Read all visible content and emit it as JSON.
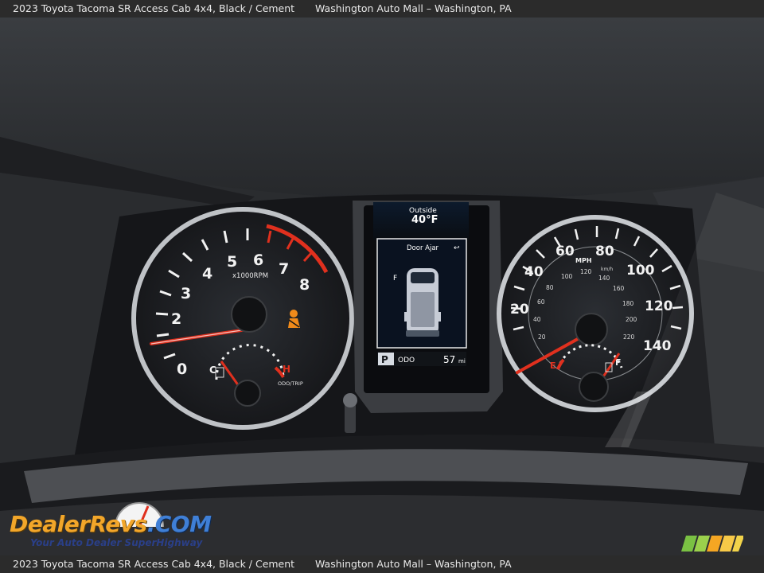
{
  "caption": {
    "title": "2023 Toyota Tacoma SR Access Cab 4x4,",
    "details": "Black / Cement",
    "dealer": "Washington Auto Mall – Washington, PA",
    "title_full_top": "2023 Toyota Tacoma SR Access Cab 4x4,   Black / Cement",
    "title_full_bottom": "2023 Toyota Tacoma SR Access Cab 4x4,   Black / Cement"
  },
  "tachometer": {
    "ticks": [
      "0",
      "2",
      "3",
      "4",
      "5",
      "6",
      "7",
      "8"
    ],
    "unit": "x1000RPM",
    "cold_label": "C",
    "hot_label": "H",
    "odo_trip_label": "ODO/TRIP"
  },
  "display": {
    "outside_label": "Outside",
    "outside_temp": "40°F",
    "alert": "Door Ajar",
    "gear": "P",
    "odo_label": "ODO",
    "odometer": "57",
    "odo_unit": "mi"
  },
  "speedometer": {
    "mph_ticks": [
      "20",
      "40",
      "60",
      "80",
      "100",
      "120",
      "140"
    ],
    "unit_mph": "MPH",
    "unit_kmh": "km/h",
    "kmh_ticks": [
      "20",
      "40",
      "60",
      "80",
      "100",
      "120",
      "140",
      "160",
      "180",
      "200",
      "220"
    ],
    "empty_label": "E",
    "full_label": "F"
  },
  "watermark": {
    "brand_a": "DealerRevs",
    "brand_b": ".COM",
    "tagline": "Your Auto Dealer SuperHighway"
  },
  "colors": {
    "accent_red": "#e0301e",
    "brand_orange": "#f2a62a",
    "brand_blue": "#3f7fd6"
  }
}
